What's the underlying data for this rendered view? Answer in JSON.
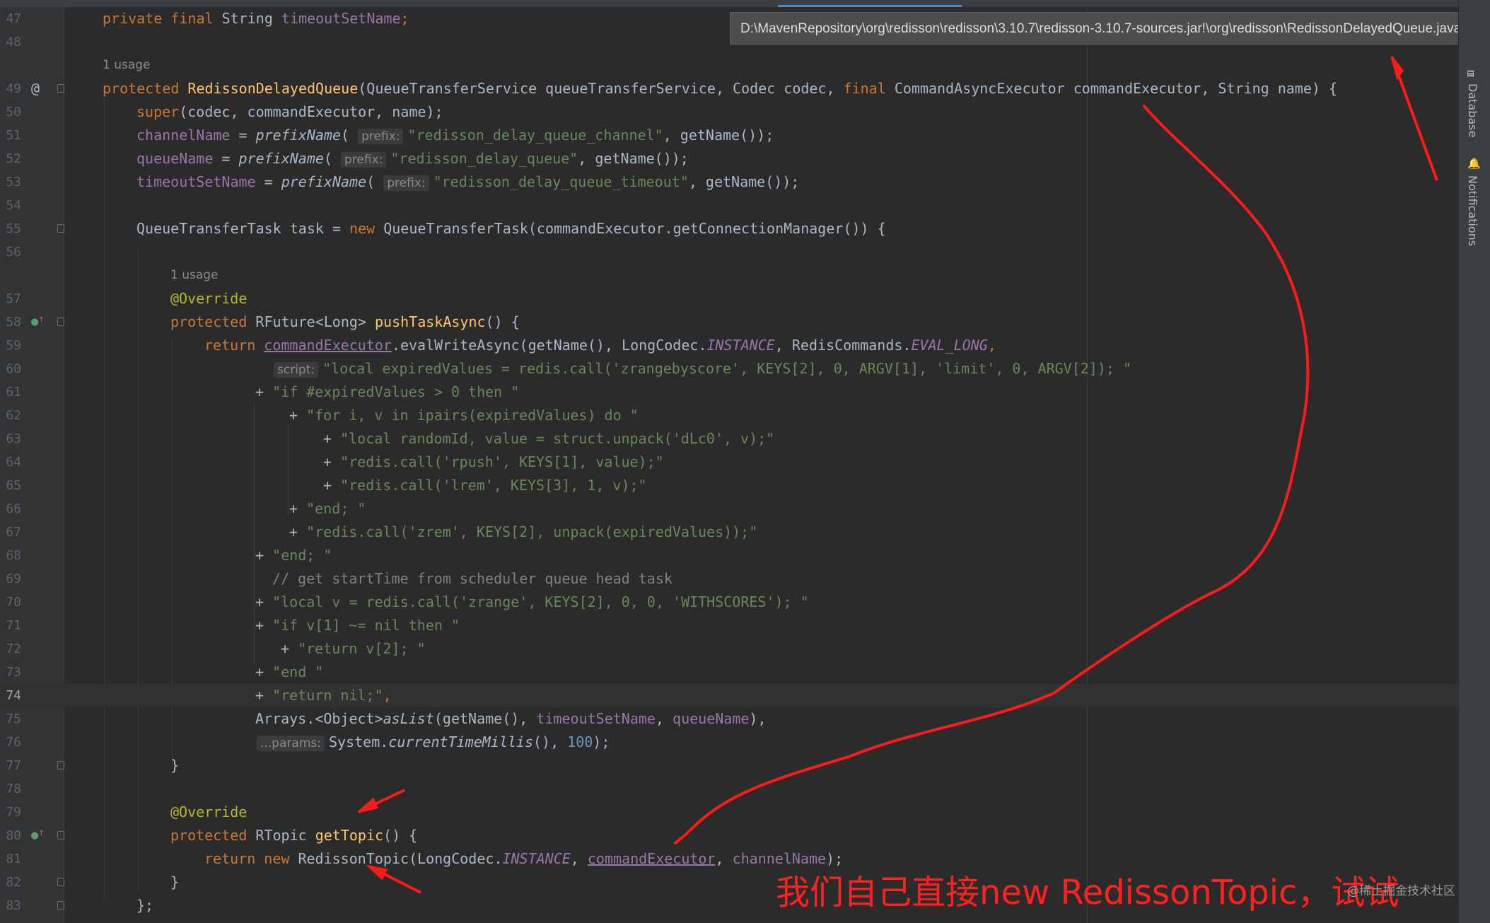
{
  "tooltip": {
    "path": "D:\\MavenRepository\\org\\redisson\\redisson\\3.10.7\\redisson-3.10.7-sources.jar!\\org\\redisson\\RedissonDelayedQueue.java"
  },
  "sidebar": {
    "database_label": "Database",
    "notifications_label": "Notifications"
  },
  "gutter": {
    "line_numbers": [
      "47",
      "48",
      "49",
      "50",
      "51",
      "52",
      "53",
      "54",
      "55",
      "56",
      "57",
      "58",
      "59",
      "60",
      "61",
      "62",
      "63",
      "64",
      "65",
      "66",
      "67",
      "68",
      "69",
      "70",
      "71",
      "72",
      "73",
      "74",
      "75",
      "76",
      "77",
      "78",
      "79",
      "80",
      "81",
      "82",
      "83"
    ]
  },
  "hints": {
    "usage_1": "1 usage",
    "usage_2": "1 usage",
    "prefix": "prefix:",
    "script": "script:",
    "params": "...params:"
  },
  "code": {
    "l47": [
      "private",
      "final",
      "String",
      "timeoutSetName",
      ";"
    ],
    "l49": [
      "protected",
      "RedissonDelayedQueue",
      "(QueueTransferService queueTransferService, Codec codec, ",
      "final",
      " CommandAsyncExecutor commandExecutor, String name) {"
    ],
    "l50": [
      "super",
      "(codec, commandExecutor, name);"
    ],
    "l51": [
      "channelName",
      " = ",
      "prefixName",
      "( ",
      "\"redisson_delay_queue_channel\"",
      ", getName());"
    ],
    "l52": [
      "queueName",
      " = ",
      "prefixName",
      "( ",
      "\"redisson_delay_queue\"",
      ", getName());"
    ],
    "l53": [
      "timeoutSetName",
      " = ",
      "prefixName",
      "( ",
      "\"redisson_delay_queue_timeout\"",
      ", getName());"
    ],
    "l55": [
      "QueueTransferTask task = ",
      "new",
      " QueueTransferTask(commandExecutor.getConnectionManager()) {"
    ],
    "l57": [
      "@Override"
    ],
    "l58": [
      "protected",
      " RFuture<Long> ",
      "pushTaskAsync",
      "() {"
    ],
    "l59": [
      "return",
      " ",
      "commandExecutor",
      ".evalWriteAsync(getName(), LongCodec.",
      "INSTANCE",
      ", RedisCommands.",
      "EVAL_LONG",
      ","
    ],
    "l60": [
      "\"local expiredValues = redis.call('zrangebyscore', KEYS[2], 0, ARGV[1], 'limit', 0, ARGV[2]); \""
    ],
    "l61": [
      "+ ",
      "\"if #expiredValues > 0 then \""
    ],
    "l62": [
      "+ ",
      "\"for i, v in ipairs(expiredValues) do \""
    ],
    "l63": [
      "+ ",
      "\"local randomId, value = struct.unpack('dLc0', v);\""
    ],
    "l64": [
      "+ ",
      "\"redis.call('rpush', KEYS[1], value);\""
    ],
    "l65": [
      "+ ",
      "\"redis.call('lrem', KEYS[3], 1, v);\""
    ],
    "l66": [
      "+ ",
      "\"end; \""
    ],
    "l67": [
      "+ ",
      "\"redis.call('zrem', KEYS[2], unpack(expiredValues));\""
    ],
    "l68": [
      "+ ",
      "\"end; \""
    ],
    "l69": [
      "// get startTime from scheduler queue head task"
    ],
    "l70": [
      "+ ",
      "\"local v = redis.call('zrange', KEYS[2], 0, 0, 'WITHSCORES'); \""
    ],
    "l71": [
      "+ ",
      "\"if v[1] ~= nil then \""
    ],
    "l72": [
      "+ ",
      "\"return v[2]; \""
    ],
    "l73": [
      "+ ",
      "\"end \""
    ],
    "l74": [
      "+ ",
      "\"return nil;\"",
      ","
    ],
    "l75": [
      "Arrays.<Object>",
      "asList",
      "(getName(), ",
      "timeoutSetName",
      ", ",
      "queueName",
      "),"
    ],
    "l76": [
      "System.",
      "currentTimeMillis",
      "(), ",
      "100",
      ");"
    ],
    "l77": [
      "}"
    ],
    "l79": [
      "@Override"
    ],
    "l80": [
      "protected",
      " RTopic ",
      "getTopic",
      "() {"
    ],
    "l81": [
      "return",
      " ",
      "new",
      " RedissonTopic(LongCodec.",
      "INSTANCE",
      ", ",
      "commandExecutor",
      ", ",
      "channelName",
      ");"
    ],
    "l82": [
      "}"
    ],
    "l83": [
      "};"
    ]
  },
  "annotation": {
    "text": "我们自己直接new RedissonTopic，试试",
    "color": "#ff2020"
  },
  "watermark": {
    "text": "@稀土掘金技术社区"
  }
}
